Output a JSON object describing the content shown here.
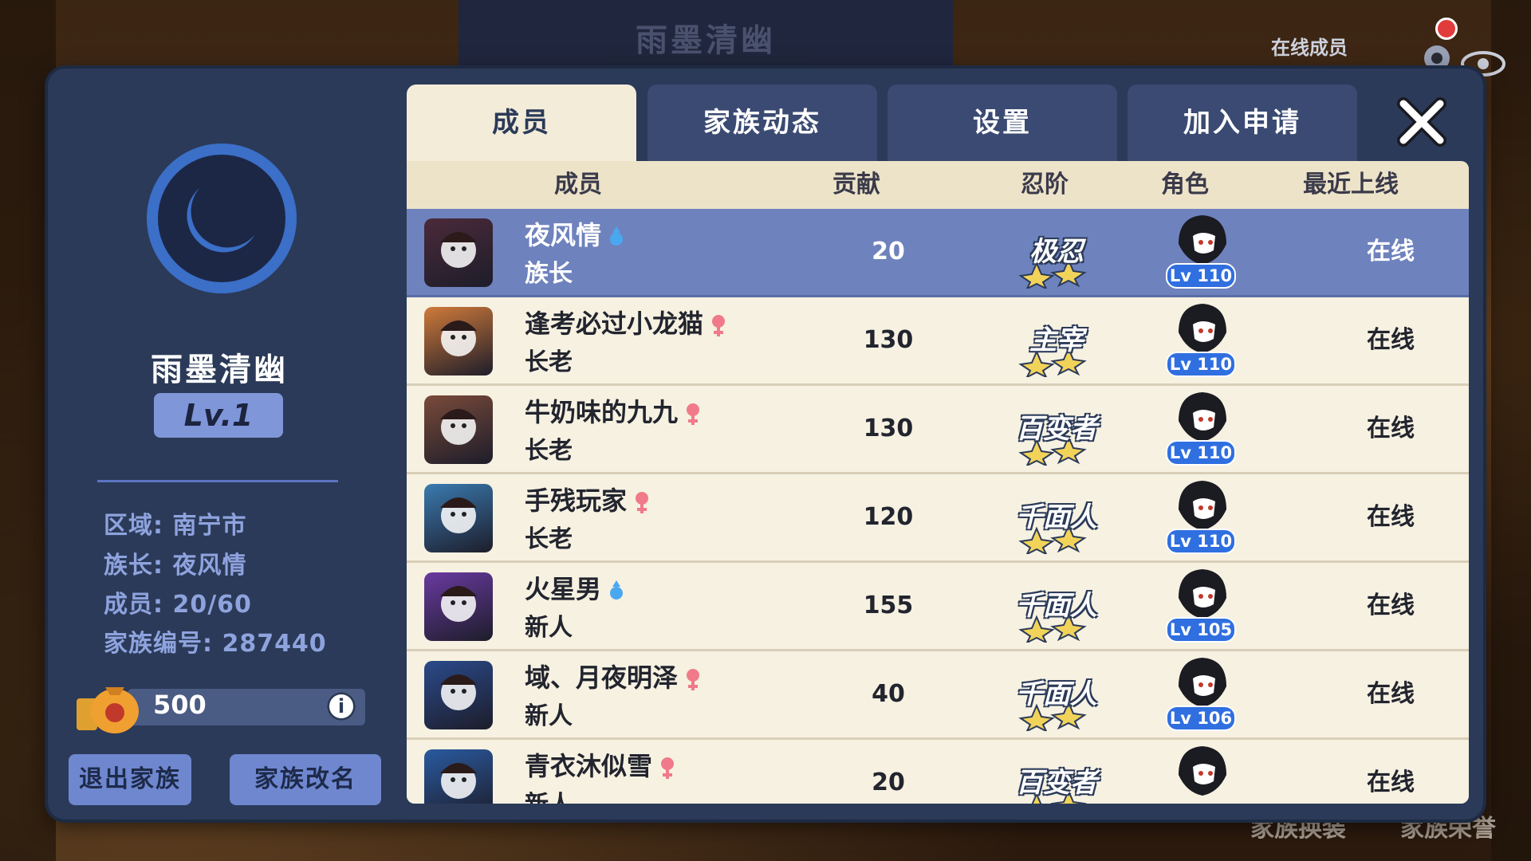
{
  "background": {
    "banner_title": "雨墨清幽",
    "online_members_label": "在线成员",
    "bottom_left_label": "家族换装",
    "bottom_right_label": "家族荣誉"
  },
  "clan": {
    "name": "雨墨清幽",
    "level": "Lv.1",
    "region": "区域: 南宁市",
    "leader": "族长: 夜风情",
    "members": "成员: 20/60",
    "clan_id": "家族编号: 287440",
    "coins": "500"
  },
  "buttons": {
    "leave": "退出家族",
    "rename": "家族改名"
  },
  "tabs": [
    {
      "label": "成员",
      "active": true
    },
    {
      "label": "家族动态",
      "active": false
    },
    {
      "label": "设置",
      "active": false
    },
    {
      "label": "加入申请",
      "active": false
    }
  ],
  "table": {
    "headers": {
      "member": "成员",
      "contribution": "贡献",
      "ninja_rank": "忍阶",
      "role": "角色",
      "last_online": "最近上线"
    },
    "rows": [
      {
        "name": "夜风情",
        "gender": "male",
        "rank": "族长",
        "contribution": "20",
        "ninja_rank": "极忍",
        "level": "Lv 110",
        "last_online": "在线",
        "highlight": true,
        "avatar_color": "#4b2a3a"
      },
      {
        "name": "逢考必过小龙猫",
        "gender": "female",
        "rank": "长老",
        "contribution": "130",
        "ninja_rank": "主宰",
        "level": "Lv 110",
        "last_online": "在线",
        "highlight": false,
        "avatar_color": "#d07a3a"
      },
      {
        "name": "牛奶味的九九",
        "gender": "female",
        "rank": "长老",
        "contribution": "130",
        "ninja_rank": "百变者",
        "level": "Lv 110",
        "last_online": "在线",
        "highlight": false,
        "avatar_color": "#7a4a3a"
      },
      {
        "name": "手残玩家",
        "gender": "female",
        "rank": "长老",
        "contribution": "120",
        "ninja_rank": "千面人",
        "level": "Lv 110",
        "last_online": "在线",
        "highlight": false,
        "avatar_color": "#3a7ab0"
      },
      {
        "name": "火星男",
        "gender": "male",
        "rank": "新人",
        "contribution": "155",
        "ninja_rank": "千面人",
        "level": "Lv 105",
        "last_online": "在线",
        "highlight": false,
        "avatar_color": "#6a3aa0"
      },
      {
        "name": "域、月夜明泽",
        "gender": "female",
        "rank": "新人",
        "contribution": "40",
        "ninja_rank": "千面人",
        "level": "Lv 106",
        "last_online": "在线",
        "highlight": false,
        "avatar_color": "#2a4a8a"
      },
      {
        "name": "青衣沐似雪",
        "gender": "female",
        "rank": "新人",
        "contribution": "20",
        "ninja_rank": "百变者",
        "level": "",
        "last_online": "在线",
        "highlight": false,
        "avatar_color": "#2a5aa0"
      }
    ]
  },
  "colors": {
    "panel": "#2b3a58",
    "active_tab": "#f3ecd9",
    "highlight_row": "#6e82bd",
    "male": "#4aa8f0",
    "female": "#f07a8a",
    "level_tag": "#2f6fe0"
  }
}
